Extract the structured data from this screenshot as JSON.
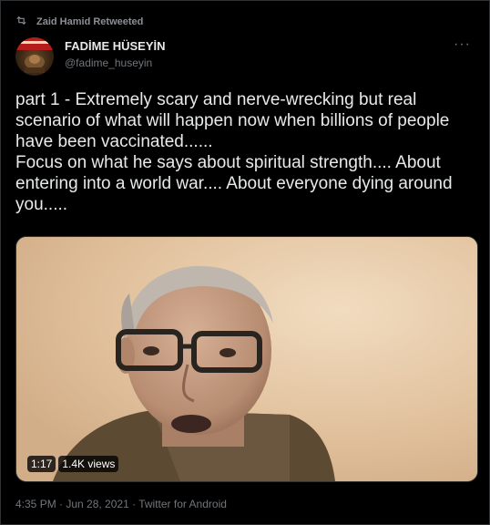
{
  "retweet": {
    "icon": "retweet-icon",
    "label": "Zaid Hamid Retweeted"
  },
  "author": {
    "name": "FADİME HÜSEYİN",
    "handle": "@fadime_huseyin",
    "more_icon": "more-icon",
    "more_glyph": "···"
  },
  "tweet": {
    "text": "part 1 - Extremely scary and nerve-wrecking but real scenario of what will happen now when billions of people have been vaccinated......\nFocus on what he says about spiritual strength.... About entering into a world war.... About everyone dying around you....."
  },
  "media": {
    "duration": "1:17",
    "views": "1.4K views"
  },
  "footer": {
    "meta": "4:35 PM · Jun 28, 2021 · Twitter for Android"
  }
}
